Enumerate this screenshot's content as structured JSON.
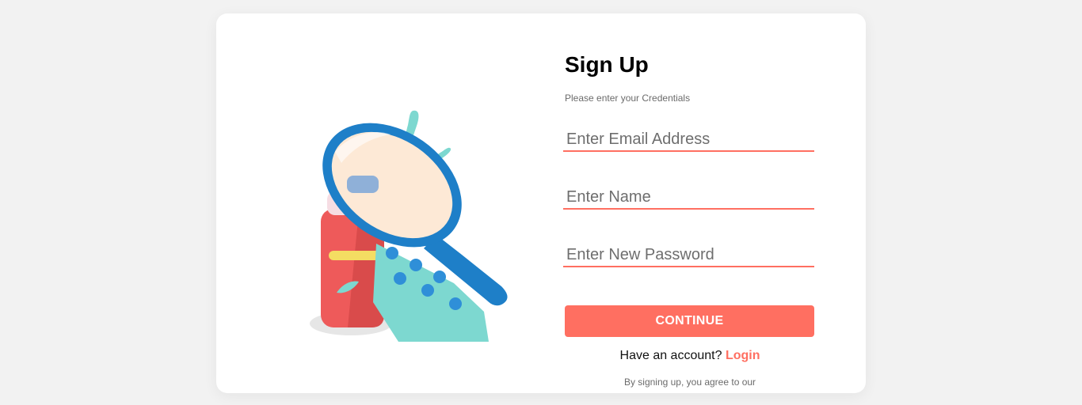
{
  "signup": {
    "title": "Sign Up",
    "subtitle": "Please enter your Credentials",
    "email_placeholder": "Enter Email Address",
    "name_placeholder": "Enter Name",
    "password_placeholder": "Enter New Password",
    "continue_label": "CONTINUE",
    "have_account_text": "Have an account? ",
    "login_label": "Login",
    "terms_text": "By signing up, you agree to our"
  },
  "illustration": {
    "icon": "magnifier-medicine-illustration"
  },
  "colors": {
    "accent": "#ff6f61",
    "background": "#f2f2f2",
    "card": "#ffffff",
    "magnifier": "#1e7fc8",
    "bottle": "#ee5a5a",
    "pill_pack": "#7dd8d0"
  }
}
